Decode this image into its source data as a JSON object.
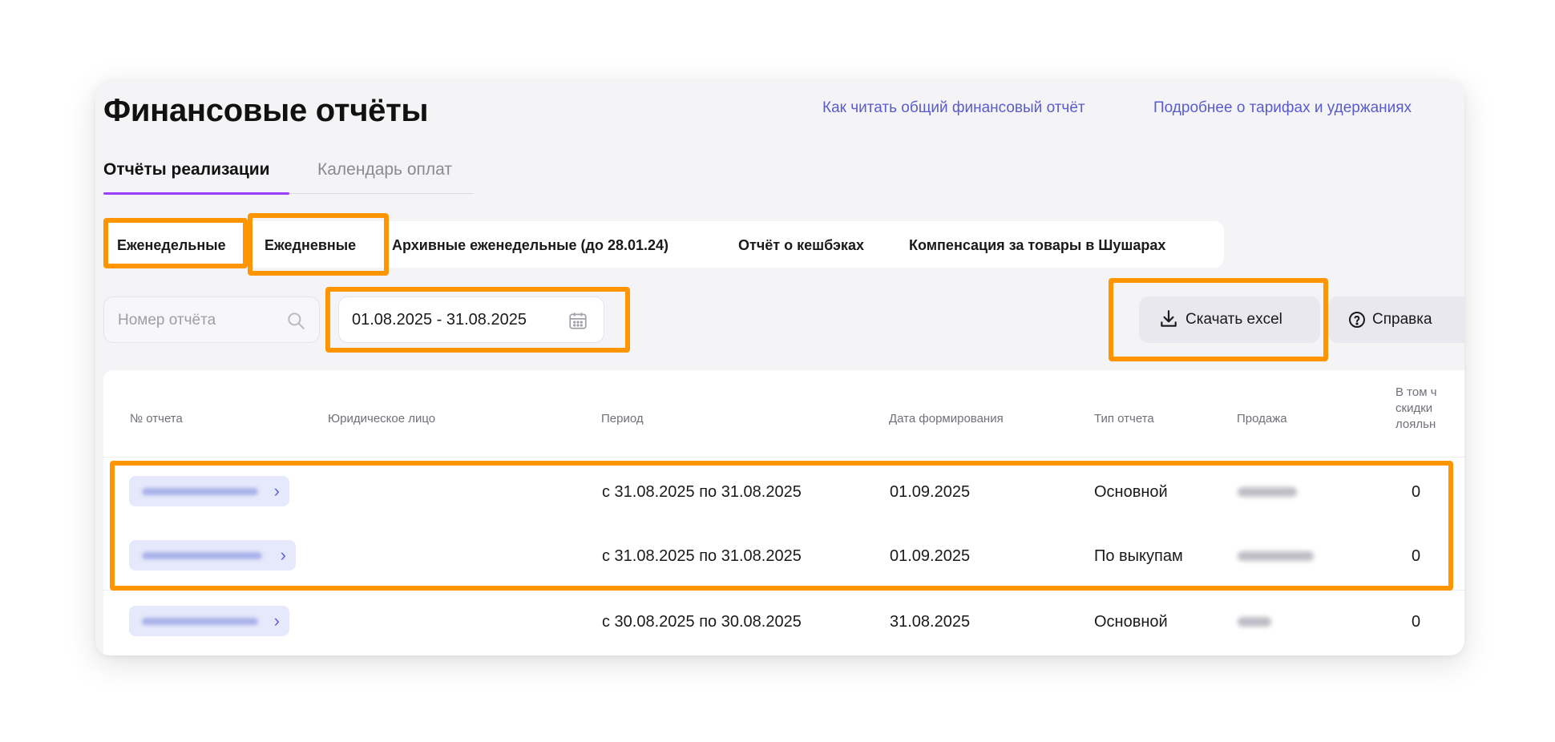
{
  "page": {
    "title": "Финансовые отчёты"
  },
  "header_links": [
    "Как читать общий финансовый отчёт",
    "Подробнее о тарифах и удержаниях"
  ],
  "main_tabs": [
    {
      "label": "Отчёты реализации",
      "active": true
    },
    {
      "label": "Календарь оплат",
      "active": false
    }
  ],
  "sub_tabs": [
    {
      "label": "Еженедельные"
    },
    {
      "label": "Ежедневные"
    },
    {
      "label": "Архивные еженедельные (до 28.01.24)"
    },
    {
      "label": "Отчёт о кешбэках"
    },
    {
      "label": "Компенсация за товары в Шушарах"
    }
  ],
  "search": {
    "placeholder": "Номер отчёта",
    "icon": "search-icon"
  },
  "date_range": {
    "value": "01.08.2025 - 31.08.2025",
    "icon": "calendar-icon"
  },
  "actions": {
    "download_label": "Скачать excel",
    "download_icon": "download-icon",
    "help_label": "Справка",
    "help_icon": "question-circle-icon"
  },
  "table": {
    "columns": [
      "№ отчета",
      "Юридическое лицо",
      "Период",
      "Дата формирования",
      "Тип отчета",
      "Продажа"
    ],
    "last_column_lines": [
      "В том ч",
      "скидки",
      "лояльн"
    ],
    "rows": [
      {
        "period": "с 31.08.2025 по 31.08.2025",
        "created": "01.09.2025",
        "type": "Основной",
        "discount": "0"
      },
      {
        "period": "с 31.08.2025 по 31.08.2025",
        "created": "01.09.2025",
        "type": "По выкупам",
        "discount": "0"
      },
      {
        "period": "с 30.08.2025 по 30.08.2025",
        "created": "31.08.2025",
        "type": "Основной",
        "discount": "0"
      }
    ]
  },
  "colors": {
    "accent_purple": "#9a3fff",
    "link_blue": "#5a5ccc",
    "highlight_orange": "#ff9500",
    "pill_bg": "#e6e9fb"
  }
}
